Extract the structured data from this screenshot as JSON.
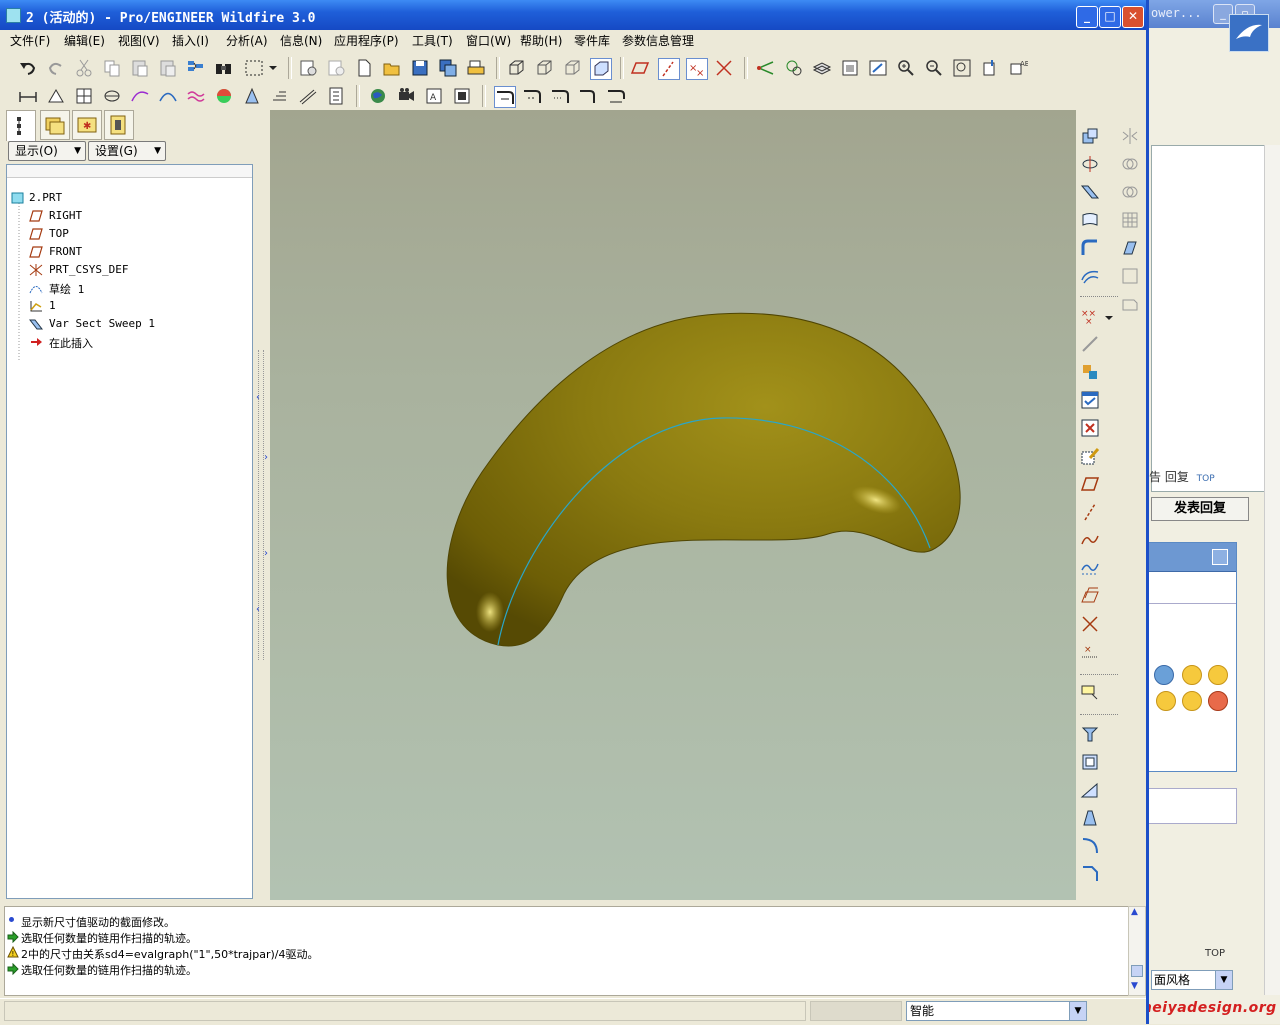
{
  "window": {
    "title": "2 (活动的) - Pro/ENGINEER Wildfire 3.0"
  },
  "menu": [
    "文件(F)",
    "编辑(E)",
    "视图(V)",
    "插入(I)",
    "分析(A)",
    "信息(N)",
    "应用程序(P)",
    "工具(T)",
    "窗口(W)",
    "帮助(H)",
    "零件库",
    "参数信息管理"
  ],
  "navigator": {
    "show_label": "显示(O)",
    "settings_label": "设置(G)",
    "tree": [
      {
        "label": "2.PRT",
        "icon": "part-icon"
      },
      {
        "label": "RIGHT",
        "icon": "datum-plane-icon"
      },
      {
        "label": "TOP",
        "icon": "datum-plane-icon"
      },
      {
        "label": "FRONT",
        "icon": "datum-plane-icon"
      },
      {
        "label": "PRT_CSYS_DEF",
        "icon": "csys-icon"
      },
      {
        "label": "草绘 1",
        "icon": "sketch-icon"
      },
      {
        "label": "1",
        "icon": "graph-icon"
      },
      {
        "label": "Var Sect Sweep 1",
        "icon": "sweep-icon"
      },
      {
        "label": "在此插入",
        "icon": "insert-here-icon"
      }
    ]
  },
  "messages": [
    {
      "type": "info",
      "text": "显示新尺寸值驱动的截面修改。"
    },
    {
      "type": "prompt",
      "text": "选取任何数量的链用作扫描的轨迹。"
    },
    {
      "type": "warning",
      "text": "2中的尺寸由关系sd4=evalgraph(\"1\",50*trajpar)/4驱动。"
    },
    {
      "type": "prompt",
      "text": "选取任何数量的链用作扫描的轨迹。"
    }
  ],
  "status": {
    "filter": "智能"
  },
  "background_window": {
    "title": "ower...",
    "reply_links": "告  回复",
    "top_link": "TOP",
    "post_button": "发表回复",
    "top_label": "TOP",
    "style_select": "面风格",
    "watermark": "www.meiyadesign.org"
  },
  "colors": {
    "title_bar": "#1f5fd9",
    "viewport_top": "#a2a58f",
    "viewport_bottom": "#b2c2b2",
    "model_surface": "#8a7a10",
    "trajectory_curve": "#2aa6c8"
  }
}
